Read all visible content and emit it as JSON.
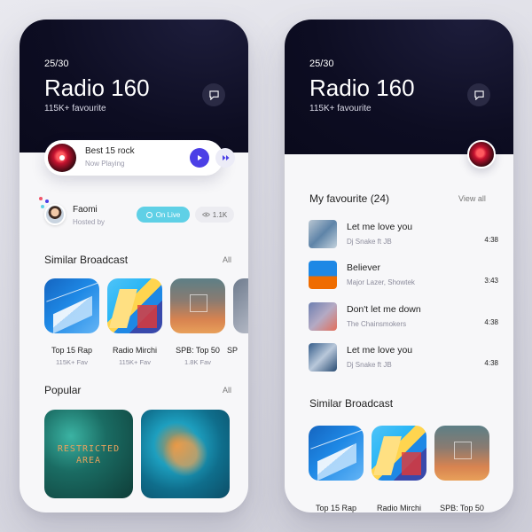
{
  "left_screen": {
    "counter": "25/30",
    "station_name": "Radio 160",
    "favourites": "115K+ favourite",
    "now_playing": {
      "title": "Best 15 rock",
      "status": "Now Playing"
    },
    "host": {
      "name": "Faomi",
      "role": "Hosted by"
    },
    "live_label": "On Live",
    "views": "1.1K",
    "similar": {
      "title": "Similar Broadcast",
      "link": "All",
      "items": [
        {
          "name": "Top 15 Rap",
          "favs": "115K+ Fav"
        },
        {
          "name": "Radio Mirchi",
          "favs": "115K+ Fav"
        },
        {
          "name": "SPB: Top 50",
          "favs": "1.8K Fav"
        },
        {
          "name": "SP",
          "favs": ""
        }
      ]
    },
    "popular": {
      "title": "Popular",
      "link": "All",
      "sign_text": "RESTRICTED AREA"
    }
  },
  "right_screen": {
    "counter": "25/30",
    "station_name": "Radio 160",
    "favourites": "115K+ favourite",
    "my_favourite": {
      "title": "My favourite (24)",
      "link": "View all",
      "songs": [
        {
          "title": "Let me love you",
          "artist": "Dj Snake ft JB",
          "duration": "4:38"
        },
        {
          "title": "Believer",
          "artist": "Major Lazer, Showtek",
          "duration": "3:43"
        },
        {
          "title": "Don't let me down",
          "artist": "The Chainsmokers",
          "duration": "4:38"
        },
        {
          "title": "Let me love you",
          "artist": "Dj Snake ft JB",
          "duration": "4:38"
        }
      ]
    },
    "similar": {
      "title": "Similar Broadcast",
      "items": [
        {
          "name": "Top 15 Rap"
        },
        {
          "name": "Radio Mirchi"
        },
        {
          "name": "SPB: Top 50"
        }
      ]
    }
  },
  "icons": [
    "chat-icon",
    "play-icon",
    "next-icon",
    "live-icon",
    "eye-icon"
  ],
  "colors": {
    "hero": "#0d0d22",
    "accent": "#4b3fe6",
    "live": "#5fd0e6"
  }
}
